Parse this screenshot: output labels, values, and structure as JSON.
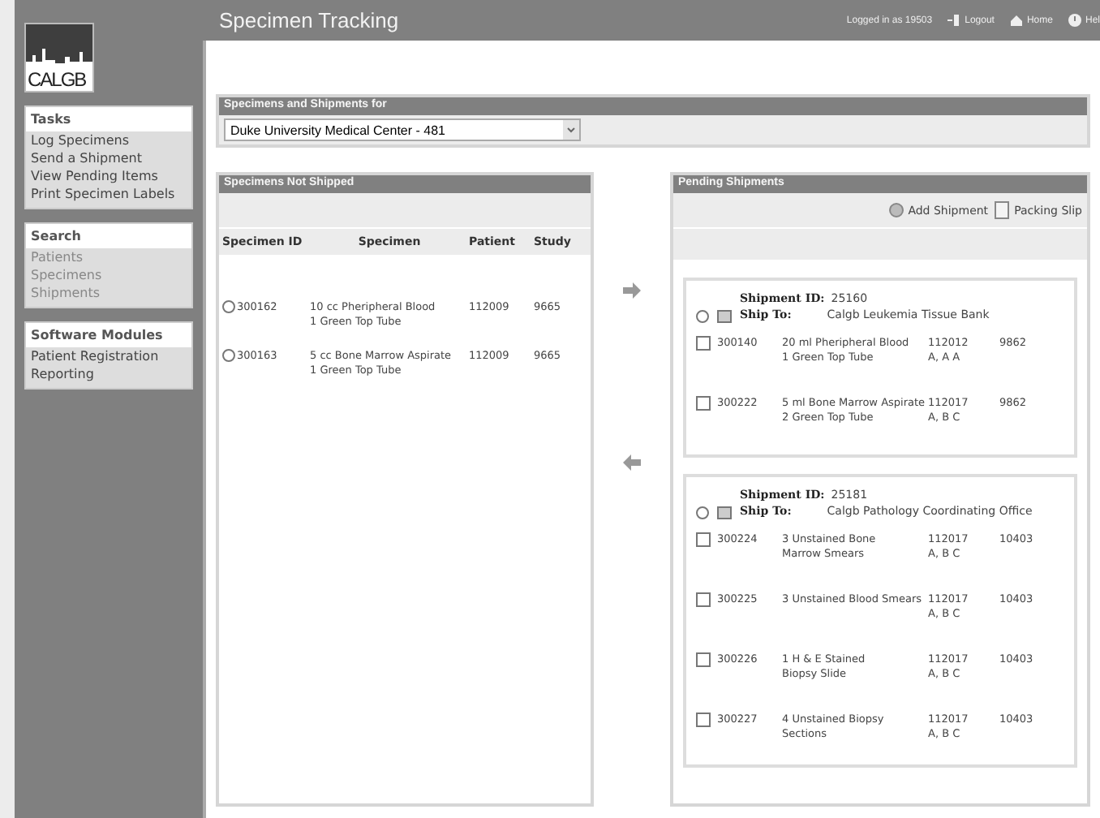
{
  "header": {
    "title": "Specimen Tracking",
    "user_text": "Logged in as 19503",
    "links": [
      {
        "label": "Logout",
        "kind": "logout"
      },
      {
        "label": "Home",
        "kind": "home"
      },
      {
        "label": "Hel",
        "kind": "help"
      }
    ]
  },
  "sidebar": {
    "logo": "CALGB",
    "sections": [
      {
        "title": "Tasks",
        "items": [
          {
            "label": "Log Specimens",
            "disabled": false
          },
          {
            "label": "Send a Shipment",
            "disabled": false
          },
          {
            "label": "View Pending Items",
            "disabled": false
          },
          {
            "label": "Print Specimen Labels",
            "disabled": false
          }
        ]
      },
      {
        "title": "Search",
        "items": [
          {
            "label": "Patients",
            "disabled": true
          },
          {
            "label": "Specimens",
            "disabled": true
          },
          {
            "label": "Shipments",
            "disabled": true
          }
        ]
      },
      {
        "title": "Software Modules",
        "items": [
          {
            "label": "Patient Registration",
            "disabled": false
          },
          {
            "label": "Reporting",
            "disabled": false
          }
        ]
      }
    ]
  },
  "site_panel": {
    "title": "Specimens and Shipments for",
    "value": "Duke University Medical Center - 481"
  },
  "specimens_panel": {
    "title": "Specimens Not Shipped",
    "columns": [
      "Specimen ID",
      "Specimen",
      "Patient",
      "Study"
    ],
    "rows": [
      {
        "id": "300162",
        "specimen": [
          "10 cc Pheripheral Blood",
          "1 Green Top Tube"
        ],
        "patient": "112009",
        "study": "9665",
        "selected": false
      },
      {
        "id": "300163",
        "specimen": [
          "5 cc Bone Marrow Aspirate",
          "1 Green Top Tube"
        ],
        "patient": "112009",
        "study": "9665",
        "selected": false
      }
    ]
  },
  "shipments_panel": {
    "title": "Pending Shipments",
    "toolbar": [
      {
        "label": "Add Shipment",
        "kind": "add"
      },
      {
        "label": "Packing Slip",
        "kind": "slip"
      }
    ],
    "shipments": [
      {
        "id_label": "Shipment ID:",
        "id": "25160",
        "ship_to_label": "Ship To:",
        "ship_to": "Calgb Leukemia Tissue Bank",
        "selected": false,
        "items": [
          {
            "id": "300140",
            "description": [
              "20 ml Pheripheral Blood",
              "1 Green Top Tube"
            ],
            "patient": [
              "112012",
              "A, A A"
            ],
            "study": "9862",
            "checked": false
          },
          {
            "id": "300222",
            "description": [
              "5 ml Bone Marrow Aspirate",
              "2 Green Top Tube"
            ],
            "patient": [
              "112017",
              "A, B C"
            ],
            "study": "9862",
            "checked": false
          }
        ]
      },
      {
        "id_label": "Shipment ID:",
        "id": "25181",
        "ship_to_label": "Ship To:",
        "ship_to": "Calgb Pathology Coordinating Office",
        "selected": false,
        "items": [
          {
            "id": "300224",
            "description": [
              "3 Unstained Bone",
              "Marrow Smears"
            ],
            "patient": [
              "112017",
              "A, B C"
            ],
            "study": "10403",
            "checked": false
          },
          {
            "id": "300225",
            "description": [
              "3 Unstained Blood Smears"
            ],
            "patient": [
              "112017",
              "A, B C"
            ],
            "study": "10403",
            "checked": false
          },
          {
            "id": "300226",
            "description": [
              "1 H & E Stained",
              "Biopsy Slide"
            ],
            "patient": [
              "112017",
              "A, B C"
            ],
            "study": "10403",
            "checked": false
          },
          {
            "id": "300227",
            "description": [
              "4 Unstained Biopsy",
              "Sections"
            ],
            "patient": [
              "112017",
              "A, B C"
            ],
            "study": "10403",
            "checked": false
          }
        ]
      }
    ]
  }
}
